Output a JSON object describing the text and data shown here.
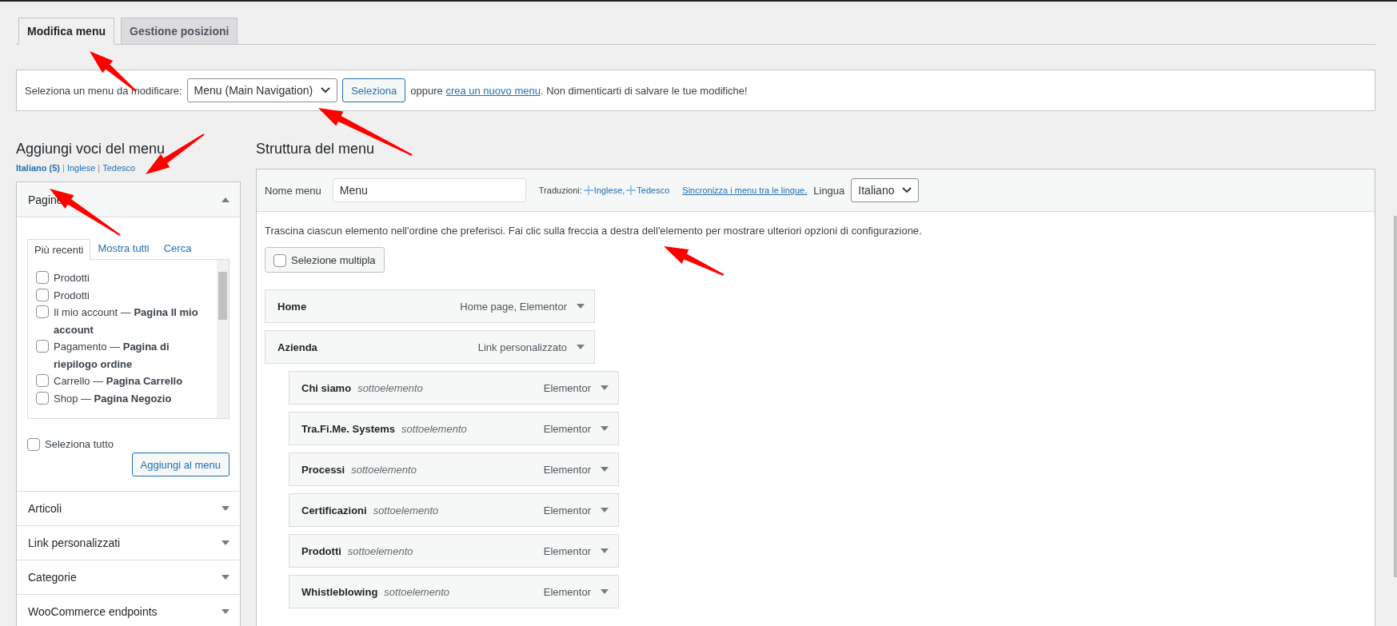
{
  "tabs": [
    {
      "label": "Modifica menu",
      "selected": true
    },
    {
      "label": "Gestione posizioni",
      "selected": false
    }
  ],
  "select_bar": {
    "label": "Seleziona un menu da modificare:",
    "menu_select": "Menu (Main Navigation)",
    "button": "Seleziona",
    "note_before": "oppure ",
    "note_link": "crea un nuovo menu",
    "note_after": ". Non dimenticarti di salvare le tue modifiche!"
  },
  "add_items": {
    "title": "Aggiungi voci del menu",
    "separator": "|",
    "languages": [
      {
        "label": "Italiano (5)",
        "selected": true
      },
      {
        "label": "Inglese",
        "selected": false
      },
      {
        "label": "Tedesco",
        "selected": false
      }
    ],
    "sections": [
      {
        "title": "Pagine",
        "expanded": true,
        "tabs": [
          {
            "label": "Più recenti",
            "selected": true
          },
          {
            "label": "Mostra tutti",
            "selected": false
          },
          {
            "label": "Cerca",
            "selected": false
          }
        ],
        "pages": [
          {
            "label": "Prodotti",
            "checked": false
          },
          {
            "label": "Prodotti",
            "checked": false
          },
          {
            "label": "Il mio account — **Pagina Il mio account**",
            "checked": false
          },
          {
            "label": "Pagamento — **Pagina di riepilogo ordine**",
            "checked": false
          },
          {
            "label": "Carrello — **Pagina Carrello**",
            "checked": false
          },
          {
            "label": "Shop — **Pagina Negozio**",
            "checked": false
          }
        ],
        "select_all": {
          "label": "Seleziona tutto",
          "checked": false
        },
        "add_button": "Aggiungi al menu"
      },
      {
        "title": "Articoli",
        "expanded": false
      },
      {
        "title": "Link personalizzati",
        "expanded": false
      },
      {
        "title": "Categorie",
        "expanded": false
      },
      {
        "title": "WooCommerce endpoints",
        "expanded": false
      }
    ]
  },
  "structure": {
    "title": "Struttura del menu",
    "name_label": "Nome menu",
    "name_value": "Menu",
    "translations_label": "Traduzioni:",
    "translations": [
      "Inglese,",
      "Tedesco"
    ],
    "sync_link": "Sincronizza i menu tra le lingue.",
    "language_label": "Lingua",
    "language_select": "Italiano",
    "instructions": "Trascina ciascun elemento nell'ordine che preferisci. Fai clic sulla freccia a destra dell'elemento per mostrare ulteriori opzioni di configurazione.",
    "bulk_select": {
      "label": "Selezione multipla",
      "checked": false
    },
    "menu_items": [
      {
        "title": "Home",
        "type": "Home page, Elementor"
      },
      {
        "title": "Azienda",
        "type": "Link personalizzato",
        "children": [
          {
            "title": "Chi siamo",
            "sublabel": "sottoelemento",
            "type": "Elementor"
          },
          {
            "title": "Tra.Fi.Me. Systems",
            "sublabel": "sottoelemento",
            "type": "Elementor"
          },
          {
            "title": "Processi",
            "sublabel": "sottoelemento",
            "type": "Elementor"
          },
          {
            "title": "Certificazioni",
            "sublabel": "sottoelemento",
            "type": "Elementor"
          },
          {
            "title": "Prodotti",
            "sublabel": "sottoelemento",
            "type": "Elementor"
          },
          {
            "title": "Whistleblowing",
            "sublabel": "sottoelemento",
            "type": "Elementor"
          }
        ]
      }
    ]
  },
  "annotations": [
    {
      "kind": "arrow"
    },
    {
      "kind": "arrow"
    },
    {
      "kind": "arrow"
    },
    {
      "kind": "arrow"
    },
    {
      "kind": "arrow"
    }
  ]
}
